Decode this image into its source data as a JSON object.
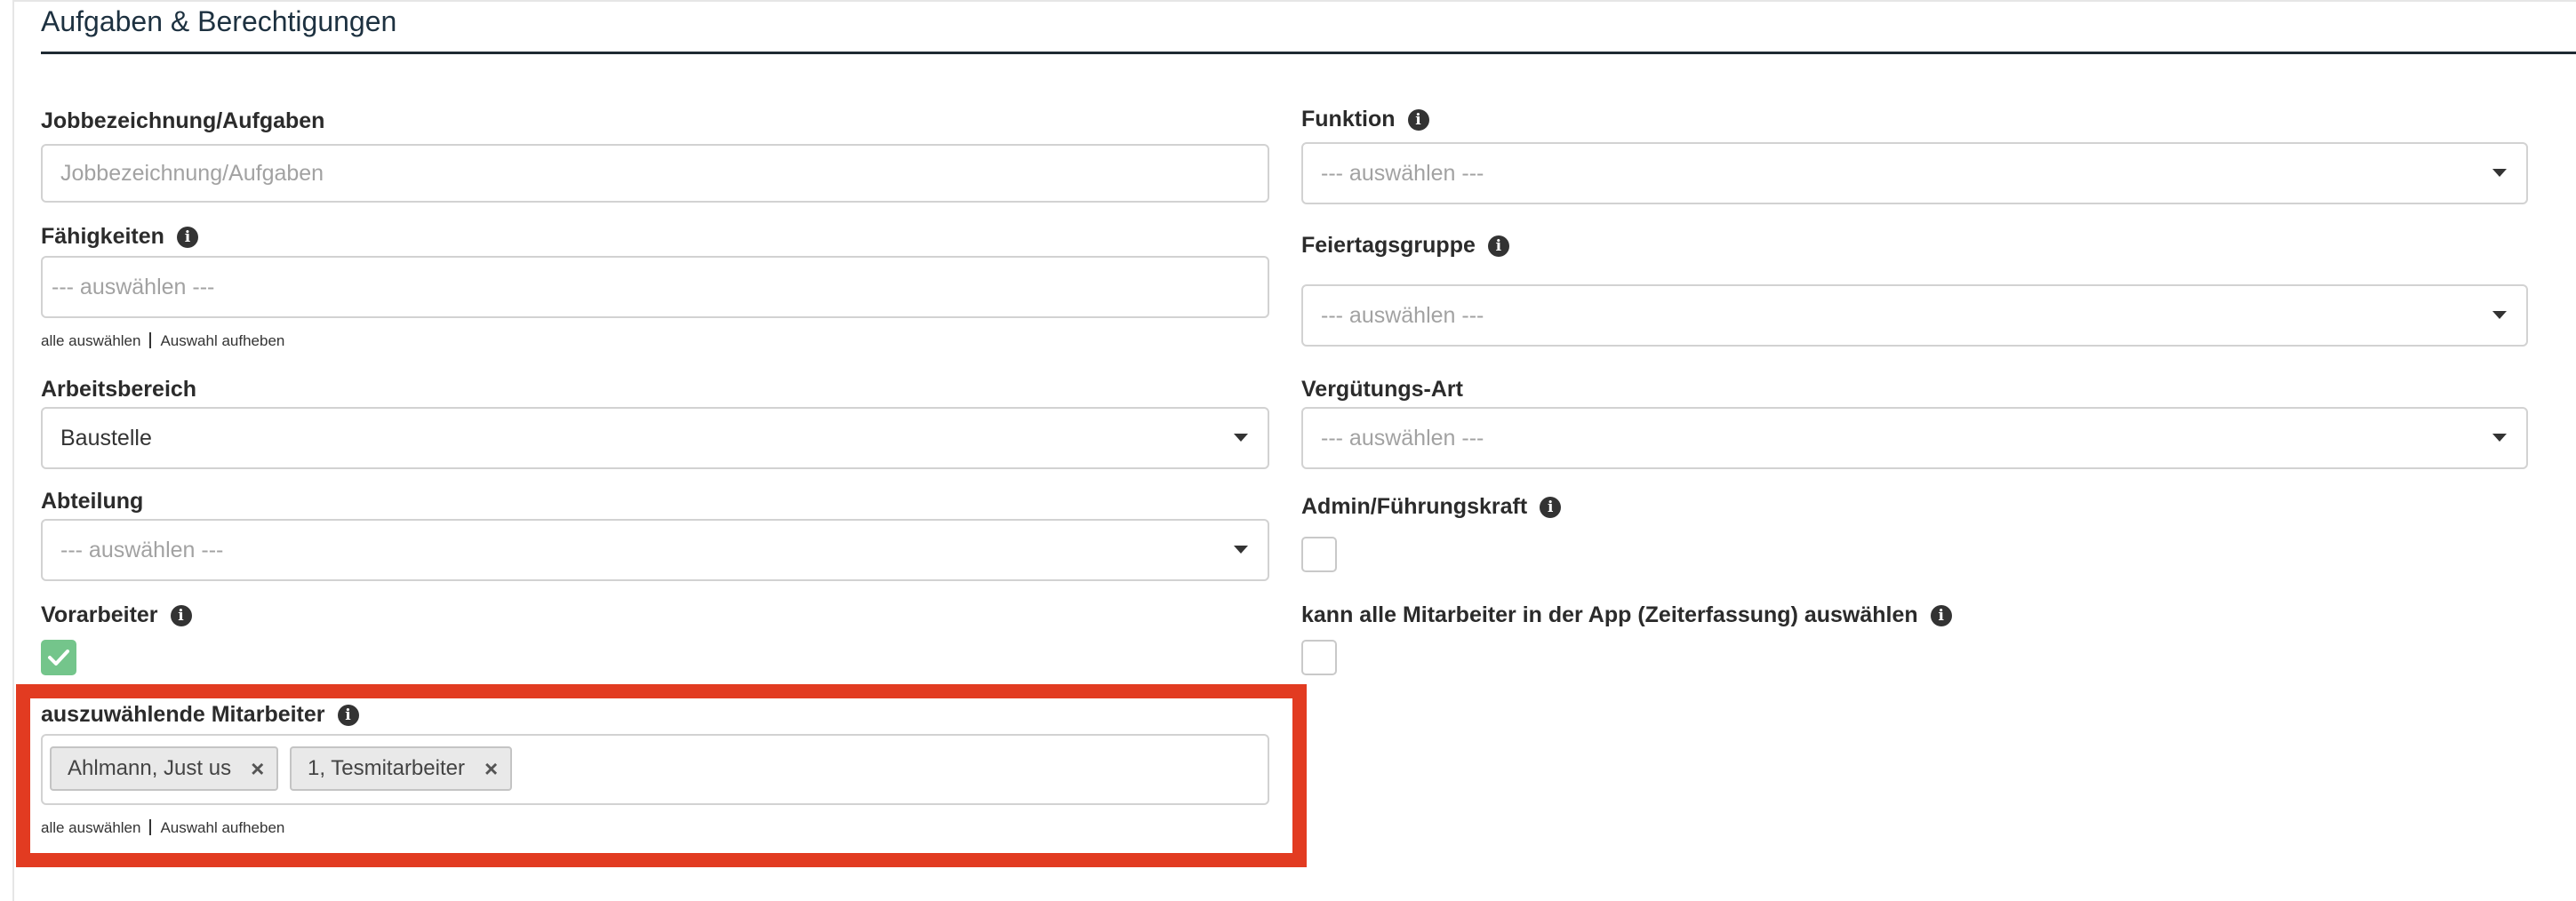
{
  "section": {
    "title": "Aufgaben & Berechtigungen"
  },
  "left": {
    "job": {
      "label": "Jobbezeichnung/Aufgaben",
      "placeholder": "Jobbezeichnung/Aufgaben"
    },
    "skills": {
      "label": "Fähigkeiten",
      "placeholder": "--- auswählen ---",
      "select_all": "alle auswählen",
      "deselect": "Auswahl aufheben"
    },
    "work_area": {
      "label": "Arbeitsbereich",
      "value": "Baustelle"
    },
    "department": {
      "label": "Abteilung",
      "placeholder": "--- auswählen ---"
    },
    "foreman": {
      "label": "Vorarbeiter",
      "checked": true
    },
    "employees": {
      "label": "auszuwählende Mitarbeiter",
      "tags": [
        "Ahlmann, Just us",
        "1, Tesmitarbeiter"
      ],
      "remove_symbol": "×",
      "select_all": "alle auswählen",
      "deselect": "Auswahl aufheben"
    }
  },
  "right": {
    "function": {
      "label": "Funktion",
      "placeholder": "--- auswählen ---"
    },
    "holiday_group": {
      "label": "Feiertagsgruppe",
      "placeholder": "--- auswählen ---"
    },
    "pay_type": {
      "label": "Vergütungs-Art",
      "placeholder": "--- auswählen ---"
    },
    "admin": {
      "label": "Admin/Führungskraft",
      "checked": false
    },
    "select_all_app": {
      "label": "kann alle Mitarbeiter in der App (Zeiterfassung) auswählen",
      "checked": false
    }
  },
  "icons": {
    "info": "i"
  },
  "colors": {
    "highlight": "#e23b21",
    "checked": "#74c58b",
    "title_rule": "#1f2a33"
  }
}
